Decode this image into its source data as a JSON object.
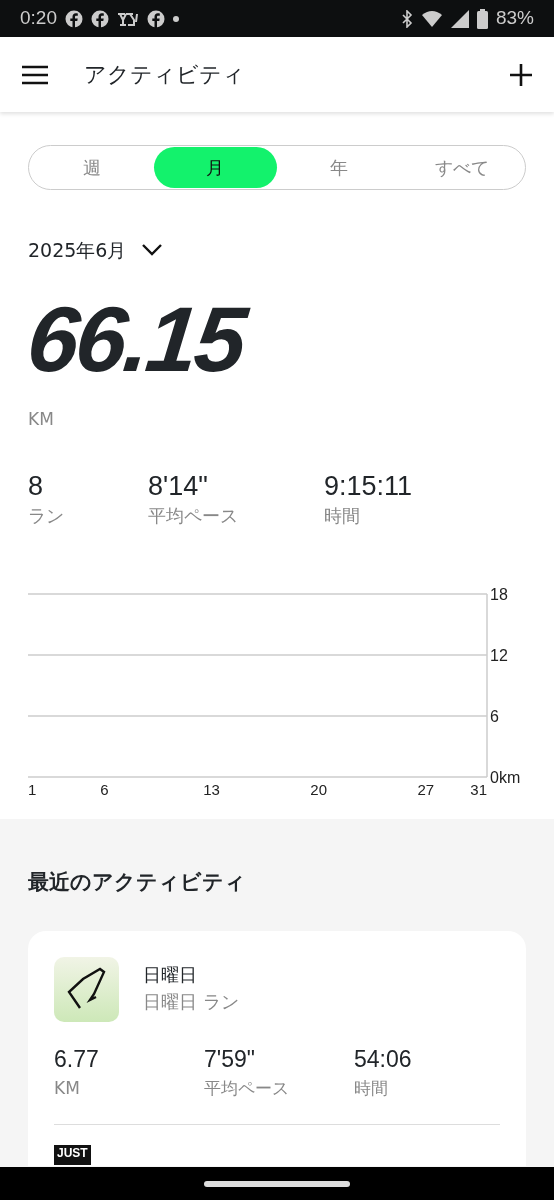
{
  "status_bar": {
    "time": "0:20",
    "battery": "83%"
  },
  "app_bar": {
    "title": "アクティビティ"
  },
  "tabs": [
    {
      "label": "週",
      "selected": false
    },
    {
      "label": "月",
      "selected": true
    },
    {
      "label": "年",
      "selected": false
    },
    {
      "label": "すべて",
      "selected": false
    }
  ],
  "period": "2025年6月",
  "total": {
    "value": "66.15",
    "unit": "KM"
  },
  "stats": [
    {
      "value": "8",
      "label": "ラン"
    },
    {
      "value": "8'14\"",
      "label": "平均ペース"
    },
    {
      "value": "9:15:11",
      "label": "時間"
    }
  ],
  "chart": {
    "chart_data": {
      "type": "bar",
      "xlim": [
        1,
        31
      ],
      "ylim": [
        0,
        18
      ],
      "xticks": [
        1,
        6,
        13,
        20,
        27,
        31
      ],
      "yticks": [
        {
          "value": 0,
          "label": "0km"
        },
        6,
        12,
        18
      ]
    }
  },
  "recent": {
    "heading": "最近のアクティビティ",
    "activities": [
      {
        "title": "日曜日",
        "subtitle": "日曜日 ラン",
        "stats": [
          {
            "value": "6.77",
            "label": "KM"
          },
          {
            "value": "7'59\"",
            "label": "平均ペース"
          },
          {
            "value": "54:06",
            "label": "時間"
          }
        ]
      }
    ],
    "badge": "JUST"
  }
}
